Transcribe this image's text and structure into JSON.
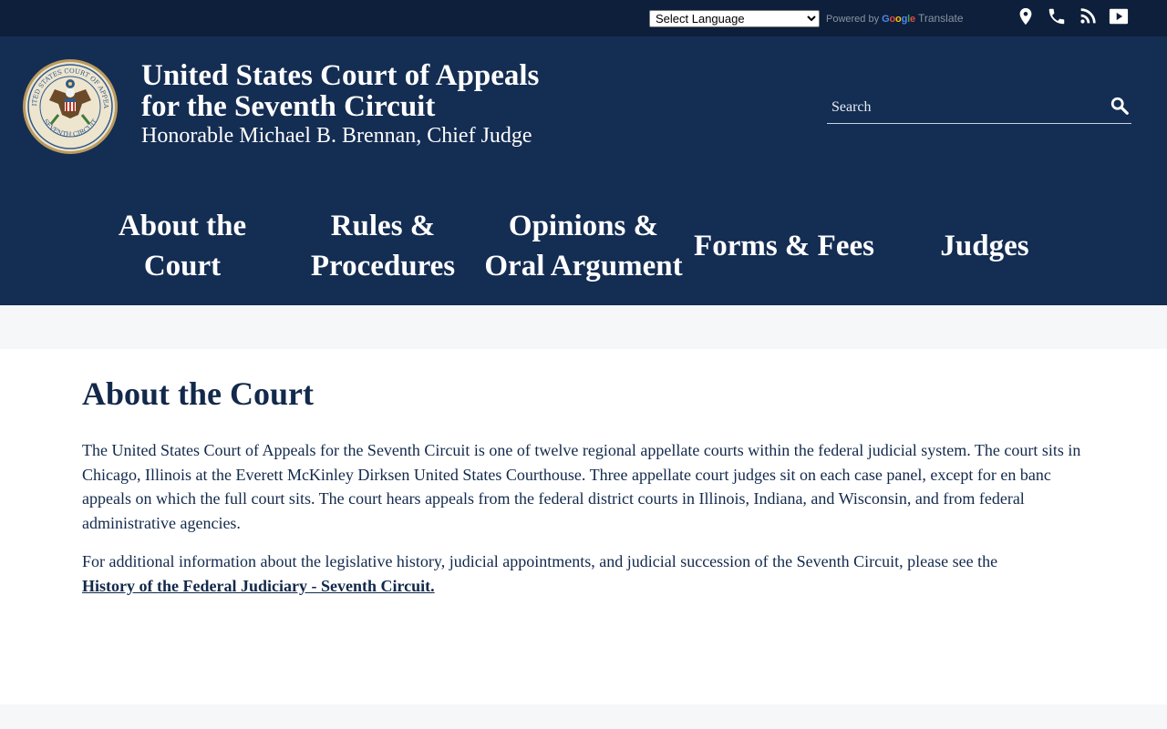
{
  "topbar": {
    "language_select": {
      "selected": "Select Language",
      "options": [
        "Select Language"
      ]
    },
    "powered_by": "Powered by",
    "google_letters": [
      "G",
      "o",
      "o",
      "g",
      "l",
      "e"
    ],
    "translate": "Translate",
    "icons": [
      "map-marker-icon",
      "phone-icon",
      "rss-icon",
      "youtube-icon"
    ]
  },
  "header": {
    "title_line1": "United States Court of Appeals",
    "title_line2": "for the Seventh Circuit",
    "subtitle": "Honorable Michael B. Brennan, Chief Judge",
    "search_placeholder": "Search",
    "seal": {
      "top_text": "UNITED STATES COURT OF APPEALS",
      "bottom_text": "SEVENTH CIRCUIT"
    }
  },
  "nav": {
    "items": [
      {
        "line1": "About the",
        "line2": "Court"
      },
      {
        "line1": "Rules &",
        "line2": "Procedures"
      },
      {
        "line1": "Opinions &",
        "line2": "Oral Argument"
      },
      {
        "line1": "Forms & Fees",
        "line2": ""
      },
      {
        "line1": "Judges",
        "line2": ""
      }
    ]
  },
  "main": {
    "title": "About the Court",
    "paragraph1": "The United States Court of Appeals for the Seventh Circuit is one of twelve regional appellate courts within the federal judicial system. The court sits in Chicago, Illinois at the Everett McKinley Dirksen United States Courthouse. Three appellate court judges sit on each case panel, except for en banc appeals on which the full court sits. The court hears appeals from the federal district courts in Illinois, Indiana, and Wisconsin, and from federal administrative agencies.",
    "paragraph2_text": "For additional information about the legislative history, judicial appointments, and judicial succession of the Seventh Circuit, please see the",
    "paragraph2_link": "History of the Federal Judiciary - Seventh Circuit."
  },
  "colors": {
    "topbar": "#0d1f3a",
    "header": "#142d53",
    "text": "#12294b",
    "page_bg": "#f6f7f9"
  }
}
